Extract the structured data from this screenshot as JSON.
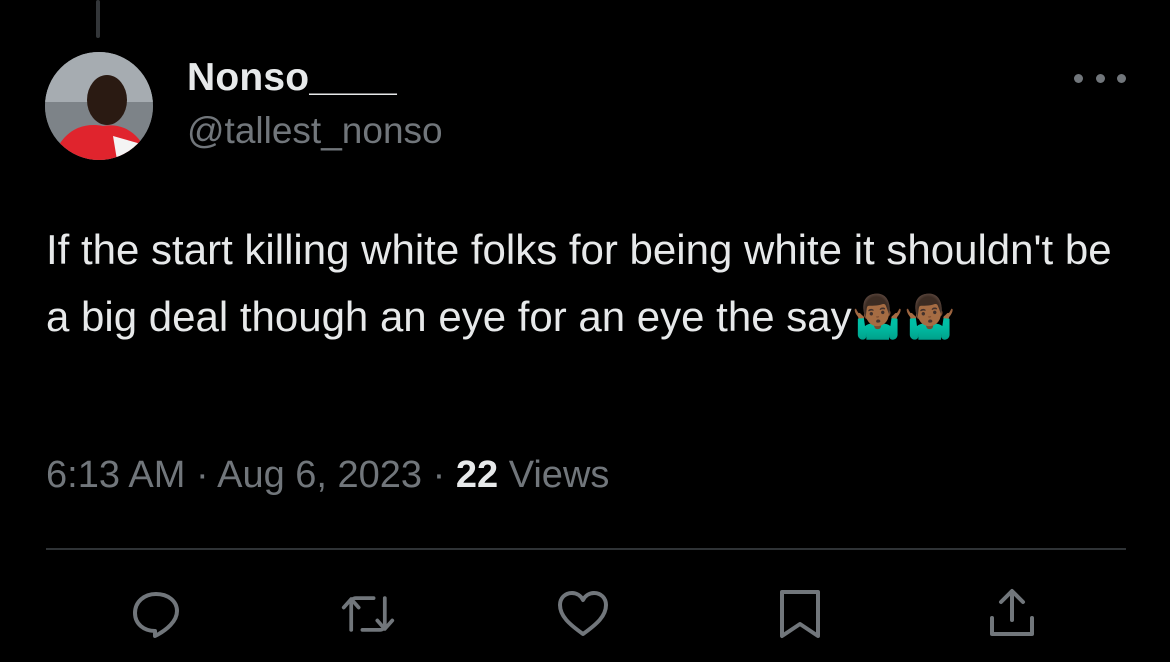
{
  "tweet": {
    "author": {
      "display_name": "Nonso____",
      "handle": "@tallest_nonso"
    },
    "text": "If the start killing white folks for being white it shouldn't be a big deal though an eye for an eye the say🤷🏾‍♂️🤷🏾‍♂️",
    "timestamp": "6:13 AM",
    "separator": "·",
    "date": "Aug 6, 2023",
    "views_count": "22",
    "views_label": "Views"
  },
  "icons": {
    "more": "more-horizontal-icon",
    "reply": "reply-icon",
    "retweet": "retweet-icon",
    "like": "heart-icon",
    "bookmark": "bookmark-icon",
    "share": "share-icon"
  },
  "colors": {
    "background": "#000000",
    "primary_text": "#e7e9ea",
    "secondary_text": "#71767b",
    "divider": "#2f3336"
  }
}
